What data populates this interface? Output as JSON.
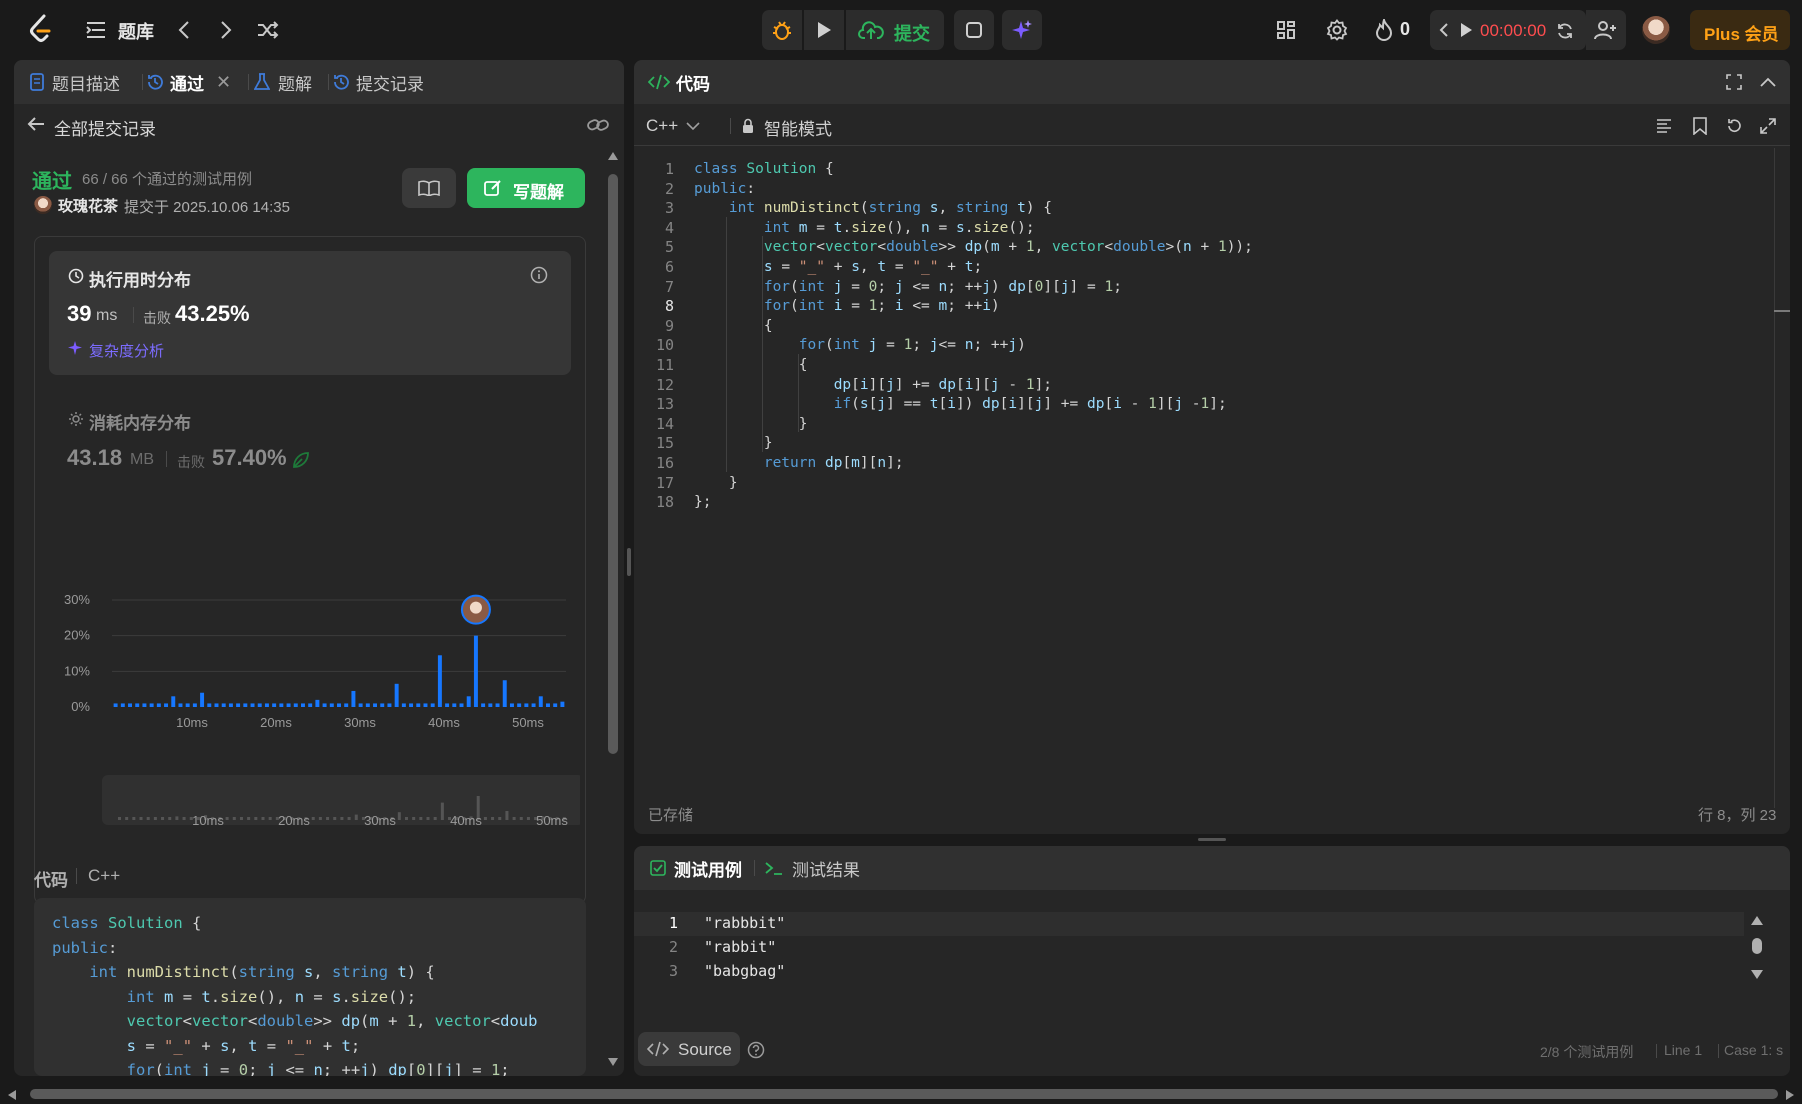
{
  "topbar": {
    "problems_label": "题库",
    "submit_label": "提交",
    "streak_count": "0",
    "timer": "00:00:00",
    "plus_label": "Plus 会员"
  },
  "left_tabs": [
    {
      "label": "题目描述"
    },
    {
      "label": "通过"
    },
    {
      "label": "题解"
    },
    {
      "label": "提交记录"
    }
  ],
  "submissions": {
    "back_label": "全部提交记录",
    "status": "通过",
    "cases": "66 / 66 个通过的测试用例",
    "user": "玫瑰花茶",
    "submitted_at": "提交于 2025.10.06 14:35",
    "write_solution_label": "写题解"
  },
  "runtime": {
    "title": "执行用时分布",
    "value": "39",
    "unit": "ms",
    "beats_label": "击败",
    "beats": "43.25%",
    "complexity_label": "复杂度分析"
  },
  "memory": {
    "title": "消耗内存分布",
    "value": "43.18",
    "unit": "MB",
    "beats_label": "击败",
    "beats": "57.40%"
  },
  "chart_data": {
    "type": "bar",
    "title": "",
    "xlabel": "",
    "ylabel": "",
    "ylim": [
      0,
      30
    ],
    "yticks": [
      "30%",
      "20%",
      "10%",
      "0%"
    ],
    "xticks": [
      "10ms",
      "20ms",
      "30ms",
      "40ms",
      "50ms"
    ],
    "x": [
      3,
      4,
      5,
      6,
      7,
      8,
      9,
      10,
      11,
      12,
      13,
      14,
      15,
      16,
      17,
      18,
      19,
      20,
      21,
      22,
      23,
      24,
      25,
      26,
      27,
      28,
      29,
      30,
      31,
      32,
      33,
      34,
      35,
      36,
      37,
      38,
      39,
      40,
      41,
      42,
      43,
      44,
      45,
      46,
      47,
      48,
      49,
      50,
      51,
      52,
      53
    ],
    "values": [
      1,
      1,
      1,
      1,
      1,
      1,
      1,
      1,
      3,
      1,
      1,
      1,
      4,
      1,
      1,
      1,
      1,
      1,
      1,
      1,
      1,
      1,
      1,
      1,
      1,
      1,
      1,
      1,
      2,
      1,
      1,
      1,
      1,
      4.5,
      1,
      1,
      1,
      1,
      1,
      6.5,
      1,
      1,
      1,
      1,
      1,
      14.5,
      1,
      1,
      1,
      3,
      20,
      1,
      1,
      1,
      7.5,
      1,
      1,
      1,
      1,
      3,
      1,
      1,
      1.5
    ],
    "highlight_x": 39,
    "grid": true
  },
  "bottom_code": {
    "header": "代码",
    "lang": "C++",
    "lines": [
      "class Solution {",
      "public:",
      "    int numDistinct(string s, string t) {",
      "        int m = t.size(), n = s.size();",
      "        vector<vector<double>> dp(m + 1, vector<doub",
      "        s = \"_\" + s, t = \"_\" + t;",
      "        for(int j = 0; j <= n; ++j) dp[0][j] = 1;"
    ]
  },
  "editor": {
    "title": "代码",
    "lang": "C++",
    "mode": "智能模式",
    "saved": "已存储",
    "cursor": "行 8，列 23",
    "lines": [
      "class Solution {",
      "public:",
      "    int numDistinct(string s, string t) {",
      "        int m = t.size(), n = s.size();",
      "        vector<vector<double>> dp(m + 1, vector<double>(n + 1));",
      "        s = \"_\" + s, t = \"_\" + t;",
      "        for(int j = 0; j <= n; ++j) dp[0][j] = 1;",
      "        for(int i = 1; i <= m; ++i)",
      "        {",
      "            for(int j = 1; j<= n; ++j)",
      "            {",
      "                dp[i][j] += dp[i][j - 1];",
      "                if(s[j] == t[i]) dp[i][j] += dp[i - 1][j -1];",
      "            }",
      "        }",
      "        return dp[m][n];",
      "    }",
      "};"
    ]
  },
  "testpanel": {
    "tab_cases": "测试用例",
    "tab_results": "测试结果",
    "lines": [
      "\"rabbbit\"",
      "\"rabbit\"",
      "\"babgbag\""
    ],
    "source_label": "Source",
    "status_cases": "2/8 个测试用例",
    "status_line": "Line 1",
    "status_case": "Case 1: s"
  },
  "colors": {
    "accent_green": "#2db55d",
    "bar_blue": "#1677ff",
    "plus_orange": "#ffa116",
    "timer_red": "#ff4d4f"
  }
}
